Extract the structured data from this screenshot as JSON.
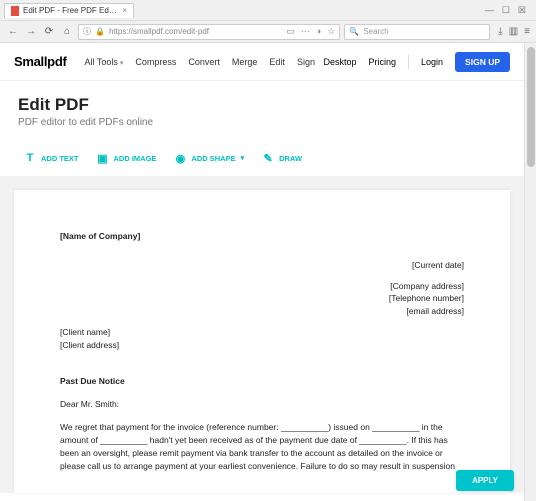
{
  "browser": {
    "tab_title": "Edit PDF - Free PDF Editor Wo…",
    "url": "https://smallpdf.com/edit-pdf",
    "search_placeholder": "Search",
    "win": {
      "min": "—",
      "max": "☐",
      "close": "☒"
    }
  },
  "header": {
    "logo": "Smallpdf",
    "menu": [
      "All Tools",
      "Compress",
      "Convert",
      "Merge",
      "Edit",
      "Sign"
    ],
    "right": {
      "desktop": "Desktop",
      "pricing": "Pricing",
      "login": "Login",
      "signup": "SIGN UP"
    }
  },
  "page": {
    "title": "Edit PDF",
    "subtitle": "PDF editor to edit PDFs online"
  },
  "toolbar": {
    "add_text": "ADD TEXT",
    "add_image": "ADD IMAGE",
    "add_shape": "ADD SHAPE",
    "draw": "DRAW"
  },
  "document": {
    "company": "[Name of Company]",
    "right_lines": [
      "[Current date]",
      "[Company address]",
      "[Telephone number]",
      "[email address]"
    ],
    "client_lines": [
      "[Client name]",
      "[Client address]"
    ],
    "notice_title": "Past Due Notice",
    "salutation": "Dear Mr. Smith:",
    "body": "We regret that payment for the invoice (reference number: __________) issued on __________ in the amount of __________ hadn't yet been received as of the payment due date of __________. If this has been an oversight, please remit payment via bank transfer to the account as detailed on the invoice or please call us to arrange payment at your earliest convenience. Failure to do so may result in suspension"
  },
  "actions": {
    "apply": "APPLY"
  }
}
